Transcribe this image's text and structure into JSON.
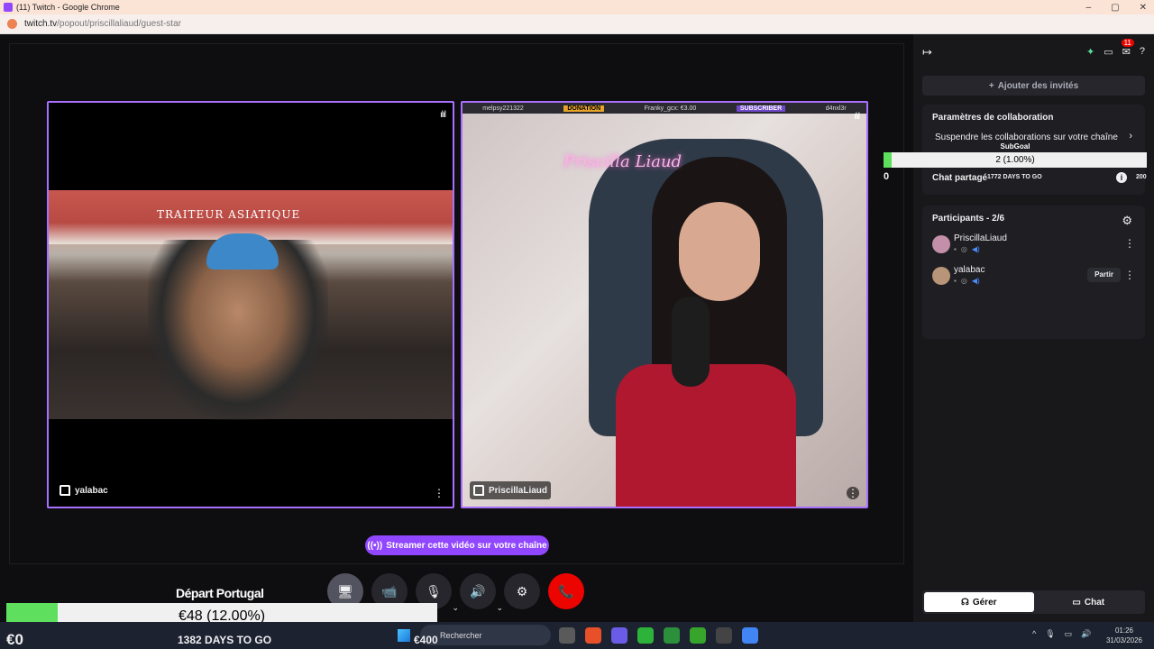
{
  "browser": {
    "title": "(11) Twitch - Google Chrome",
    "url_host": "twitch.tv",
    "url_path": "/popout/priscillaliaud/guest-star",
    "minimize": "–",
    "maximize": "▢",
    "close": "✕"
  },
  "tiles": {
    "left": {
      "name": "yalabac",
      "menu": "⋮",
      "audio": "ılıl"
    },
    "right": {
      "name": "PriscillaLiaud",
      "menu": "⋮",
      "audio": "ılıl",
      "overlay": {
        "user1": "melpsy221322",
        "donation_badge": "DONATION",
        "donation_text": "Franky_gcx: €3.00",
        "sub_badge": "SUBSCRIBER",
        "sub_user": "d4nxl3r"
      },
      "neon_sign": "Priscilla Liaud"
    },
    "storefront_sign": "TRAITEUR ASIATIQUE"
  },
  "stream_button": "Streamer cette vidéo sur votre chaîne",
  "controls": {
    "screen": "🖥",
    "camera": "📹",
    "mic": "🎙",
    "volume": "🔊",
    "settings": "⚙",
    "hangup": "📞",
    "caret": "⌄"
  },
  "sidebar": {
    "collapse": "↦",
    "notif_count": "11",
    "invite_label": "Ajouter des invités",
    "collab": {
      "title": "Paramètres de collaboration",
      "suspend": "Suspendre les collaborations sur votre chaîne",
      "chevron": "›",
      "shared_chat": "Chat partagé",
      "info": "i"
    },
    "participants": {
      "title": "Participants - 2/6",
      "list": [
        {
          "name": "PriscillaLiaud"
        },
        {
          "name": "yalabac",
          "leave": "Partir"
        }
      ],
      "menu": "⋮"
    },
    "tabs": {
      "manage": "Gérer",
      "chat": "Chat"
    }
  },
  "subgoal": {
    "title": "SubGoal",
    "progress_text": "2 (1.00%)",
    "progress": 0.01,
    "min": "0",
    "days": "1772 DAYS TO GO",
    "max": "200"
  },
  "goal": {
    "title": "Départ Portugal",
    "progress_text": "€48 (12.00%)",
    "progress": 0.12,
    "min": "€0",
    "days": "1382 DAYS TO GO",
    "max": "€400"
  },
  "taskbar": {
    "search": "Rechercher",
    "time": "01:26",
    "date": "31/03/2026",
    "app_colors": [
      "#5a5a5a",
      "#e8502a",
      "#6b5ce7",
      "#2eb33a",
      "#2c8f3c",
      "#37a42c",
      "#444",
      "#4285f4"
    ]
  }
}
